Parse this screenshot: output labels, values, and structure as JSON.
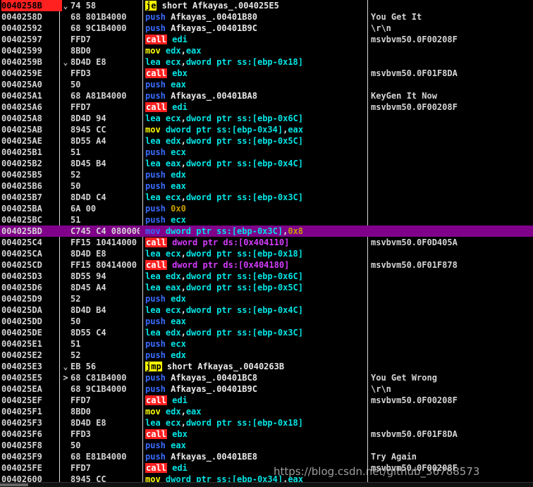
{
  "watermark": "https://blog.csdn.net/github_36788573",
  "rows": [
    {
      "addr": "0040258B",
      "mark": "⌄",
      "hex": "74 58",
      "ins": [
        [
          "je",
          "jmp"
        ],
        [
          " short ",
          "txt"
        ],
        [
          "Afkayas_.004025E5",
          "txt"
        ]
      ],
      "cmt": "",
      "eip": true
    },
    {
      "addr": "0040258D",
      "hex": "68 801B4000",
      "ins": [
        [
          "push",
          "mn"
        ],
        [
          " Afkayas_.00401B80",
          "txt"
        ]
      ],
      "cmt": "You Get It"
    },
    {
      "addr": "00402592",
      "hex": "68 9C1B4000",
      "ins": [
        [
          "push",
          "mn"
        ],
        [
          " Afkayas_.00401B9C",
          "txt"
        ]
      ],
      "cmt": "\\r\\n"
    },
    {
      "addr": "00402597",
      "hex": "FFD7",
      "ins": [
        [
          "call",
          "call"
        ],
        [
          " edi",
          "reg"
        ]
      ],
      "cmt": "msvbvm50.0F00208F"
    },
    {
      "addr": "00402599",
      "hex": "8BD0",
      "ins": [
        [
          "mov",
          "mov"
        ],
        [
          " edx",
          "reg"
        ],
        [
          ",",
          "txt"
        ],
        [
          "eax",
          "reg"
        ]
      ],
      "cmt": ""
    },
    {
      "addr": "0040259B",
      "mark": "⌄",
      "hex": "8D4D E8",
      "ins": [
        [
          "lea",
          "lea"
        ],
        [
          " ecx",
          "reg"
        ],
        [
          ",",
          "txt"
        ],
        [
          "dword ptr ss:[ebp-0x18]",
          "reg"
        ]
      ],
      "cmt": ""
    },
    {
      "addr": "0040259E",
      "hex": "FFD3",
      "ins": [
        [
          "call",
          "call"
        ],
        [
          " ebx",
          "reg"
        ]
      ],
      "cmt": "msvbvm50.0F01F8DA"
    },
    {
      "addr": "004025A0",
      "hex": "50",
      "ins": [
        [
          "push",
          "mn"
        ],
        [
          " eax",
          "reg"
        ]
      ],
      "cmt": ""
    },
    {
      "addr": "004025A1",
      "hex": "68 A81B4000",
      "ins": [
        [
          "push",
          "mn"
        ],
        [
          " Afkayas_.00401BA8",
          "txt"
        ]
      ],
      "cmt": "KeyGen It Now"
    },
    {
      "addr": "004025A6",
      "hex": "FFD7",
      "ins": [
        [
          "call",
          "call"
        ],
        [
          " edi",
          "reg"
        ]
      ],
      "cmt": "msvbvm50.0F00208F"
    },
    {
      "addr": "004025A8",
      "hex": "8D4D 94",
      "ins": [
        [
          "lea",
          "lea"
        ],
        [
          " ecx",
          "reg"
        ],
        [
          ",",
          "txt"
        ],
        [
          "dword ptr ss:[ebp-0x6C]",
          "reg"
        ]
      ],
      "cmt": ""
    },
    {
      "addr": "004025AB",
      "hex": "8945 CC",
      "ins": [
        [
          "mov",
          "mov"
        ],
        [
          " dword ptr ss:[ebp-0x34]",
          "reg"
        ],
        [
          ",",
          "txt"
        ],
        [
          "eax",
          "reg"
        ]
      ],
      "cmt": ""
    },
    {
      "addr": "004025AE",
      "hex": "8D55 A4",
      "ins": [
        [
          "lea",
          "lea"
        ],
        [
          " edx",
          "reg"
        ],
        [
          ",",
          "txt"
        ],
        [
          "dword ptr ss:[ebp-0x5C]",
          "reg"
        ]
      ],
      "cmt": ""
    },
    {
      "addr": "004025B1",
      "hex": "51",
      "ins": [
        [
          "push",
          "mn"
        ],
        [
          " ecx",
          "reg"
        ]
      ],
      "cmt": ""
    },
    {
      "addr": "004025B2",
      "hex": "8D45 B4",
      "ins": [
        [
          "lea",
          "lea"
        ],
        [
          " eax",
          "reg"
        ],
        [
          ",",
          "txt"
        ],
        [
          "dword ptr ss:[ebp-0x4C]",
          "reg"
        ]
      ],
      "cmt": ""
    },
    {
      "addr": "004025B5",
      "hex": "52",
      "ins": [
        [
          "push",
          "mn"
        ],
        [
          " edx",
          "reg"
        ]
      ],
      "cmt": ""
    },
    {
      "addr": "004025B6",
      "hex": "50",
      "ins": [
        [
          "push",
          "mn"
        ],
        [
          " eax",
          "reg"
        ]
      ],
      "cmt": ""
    },
    {
      "addr": "004025B7",
      "hex": "8D4D C4",
      "ins": [
        [
          "lea",
          "lea"
        ],
        [
          " ecx",
          "reg"
        ],
        [
          ",",
          "txt"
        ],
        [
          "dword ptr ss:[ebp-0x3C]",
          "reg"
        ]
      ],
      "cmt": ""
    },
    {
      "addr": "004025BA",
      "hex": "6A 00",
      "ins": [
        [
          "push",
          "mn"
        ],
        [
          " 0x0",
          "imm"
        ]
      ],
      "cmt": ""
    },
    {
      "addr": "004025BC",
      "hex": "51",
      "ins": [
        [
          "push",
          "mn"
        ],
        [
          " ecx",
          "reg"
        ]
      ],
      "cmt": ""
    },
    {
      "addr": "004025BD",
      "hex": "C745 C4 080000",
      "ins": [
        [
          "mov",
          "mn"
        ],
        [
          " dword ptr ss:[ebp-0x3C]",
          "reg"
        ],
        [
          ",",
          "txt"
        ],
        [
          "0x8",
          "imm"
        ]
      ],
      "cmt": "",
      "sel": true
    },
    {
      "addr": "004025C4",
      "hex": "FF15 10414000",
      "ins": [
        [
          "call",
          "call"
        ],
        [
          " dword ptr ds:[0x404110]",
          "mem"
        ]
      ],
      "cmt": "msvbvm50.0F0D405A"
    },
    {
      "addr": "004025CA",
      "hex": "8D4D E8",
      "ins": [
        [
          "lea",
          "lea"
        ],
        [
          " ecx",
          "reg"
        ],
        [
          ",",
          "txt"
        ],
        [
          "dword ptr ss:[ebp-0x18]",
          "reg"
        ]
      ],
      "cmt": ""
    },
    {
      "addr": "004025CD",
      "hex": "FF15 80414000",
      "ins": [
        [
          "call",
          "call"
        ],
        [
          " dword ptr ds:[0x404180]",
          "mem"
        ]
      ],
      "cmt": "msvbvm50.0F01F878"
    },
    {
      "addr": "004025D3",
      "hex": "8D55 94",
      "ins": [
        [
          "lea",
          "lea"
        ],
        [
          " edx",
          "reg"
        ],
        [
          ",",
          "txt"
        ],
        [
          "dword ptr ss:[ebp-0x6C]",
          "reg"
        ]
      ],
      "cmt": ""
    },
    {
      "addr": "004025D6",
      "hex": "8D45 A4",
      "ins": [
        [
          "lea",
          "lea"
        ],
        [
          " eax",
          "reg"
        ],
        [
          ",",
          "txt"
        ],
        [
          "dword ptr ss:[ebp-0x5C]",
          "reg"
        ]
      ],
      "cmt": ""
    },
    {
      "addr": "004025D9",
      "hex": "52",
      "ins": [
        [
          "push",
          "mn"
        ],
        [
          " edx",
          "reg"
        ]
      ],
      "cmt": ""
    },
    {
      "addr": "004025DA",
      "hex": "8D4D B4",
      "ins": [
        [
          "lea",
          "lea"
        ],
        [
          " ecx",
          "reg"
        ],
        [
          ",",
          "txt"
        ],
        [
          "dword ptr ss:[ebp-0x4C]",
          "reg"
        ]
      ],
      "cmt": ""
    },
    {
      "addr": "004025DD",
      "hex": "50",
      "ins": [
        [
          "push",
          "mn"
        ],
        [
          " eax",
          "reg"
        ]
      ],
      "cmt": ""
    },
    {
      "addr": "004025DE",
      "hex": "8D55 C4",
      "ins": [
        [
          "lea",
          "lea"
        ],
        [
          " edx",
          "reg"
        ],
        [
          ",",
          "txt"
        ],
        [
          "dword ptr ss:[ebp-0x3C]",
          "reg"
        ]
      ],
      "cmt": ""
    },
    {
      "addr": "004025E1",
      "hex": "51",
      "ins": [
        [
          "push",
          "mn"
        ],
        [
          " ecx",
          "reg"
        ]
      ],
      "cmt": ""
    },
    {
      "addr": "004025E2",
      "hex": "52",
      "ins": [
        [
          "push",
          "mn"
        ],
        [
          " edx",
          "reg"
        ]
      ],
      "cmt": ""
    },
    {
      "addr": "004025E3",
      "mark": "⌄",
      "hex": "EB 56",
      "ins": [
        [
          "jmp",
          "jmp"
        ],
        [
          " short Afkayas_.0040263B",
          "txt"
        ]
      ],
      "cmt": ""
    },
    {
      "addr": "004025E5",
      "mark": "&gt;",
      "hex": "68 C81B4000",
      "ins": [
        [
          "push",
          "mn"
        ],
        [
          " Afkayas_.00401BC8",
          "txt"
        ]
      ],
      "cmt": "You Get Wrong"
    },
    {
      "addr": "004025EA",
      "hex": "68 9C1B4000",
      "ins": [
        [
          "push",
          "mn"
        ],
        [
          " Afkayas_.00401B9C",
          "txt"
        ]
      ],
      "cmt": "\\r\\n"
    },
    {
      "addr": "004025EF",
      "hex": "FFD7",
      "ins": [
        [
          "call",
          "call"
        ],
        [
          " edi",
          "reg"
        ]
      ],
      "cmt": "msvbvm50.0F00208F"
    },
    {
      "addr": "004025F1",
      "hex": "8BD0",
      "ins": [
        [
          "mov",
          "mov"
        ],
        [
          " edx",
          "reg"
        ],
        [
          ",",
          "txt"
        ],
        [
          "eax",
          "reg"
        ]
      ],
      "cmt": ""
    },
    {
      "addr": "004025F3",
      "hex": "8D4D E8",
      "ins": [
        [
          "lea",
          "lea"
        ],
        [
          " ecx",
          "reg"
        ],
        [
          ",",
          "txt"
        ],
        [
          "dword ptr ss:[ebp-0x18]",
          "reg"
        ]
      ],
      "cmt": ""
    },
    {
      "addr": "004025F6",
      "hex": "FFD3",
      "ins": [
        [
          "call",
          "call"
        ],
        [
          " ebx",
          "reg"
        ]
      ],
      "cmt": "msvbvm50.0F01F8DA"
    },
    {
      "addr": "004025F8",
      "hex": "50",
      "ins": [
        [
          "push",
          "mn"
        ],
        [
          " eax",
          "reg"
        ]
      ],
      "cmt": ""
    },
    {
      "addr": "004025F9",
      "hex": "68 E81B4000",
      "ins": [
        [
          "push",
          "mn"
        ],
        [
          " Afkayas_.00401BE8",
          "txt"
        ]
      ],
      "cmt": "Try Again"
    },
    {
      "addr": "004025FE",
      "hex": "FFD7",
      "ins": [
        [
          "call",
          "call"
        ],
        [
          " edi",
          "reg"
        ]
      ],
      "cmt": "msvbvm50.0F00208F"
    },
    {
      "addr": "00402600",
      "hex": "8945 CC",
      "ins": [
        [
          "mov",
          "mov"
        ],
        [
          " dword ptr ss:[ebp-0x34]",
          "reg"
        ],
        [
          ",",
          "txt"
        ],
        [
          "eax",
          "reg"
        ]
      ],
      "cmt": ""
    }
  ]
}
